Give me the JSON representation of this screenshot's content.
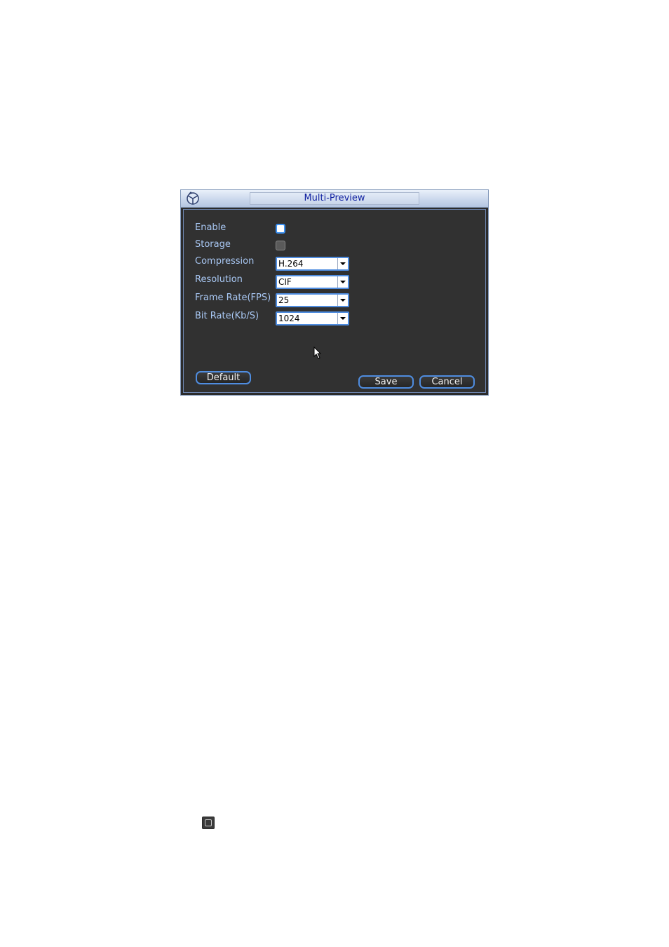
{
  "dialog": {
    "title": "Multi-Preview",
    "icon": "dvr-logo-icon",
    "fields": {
      "enable_label": "Enable",
      "storage_label": "Storage",
      "compression_label": "Compression",
      "compression_value": "H.264",
      "resolution_label": "Resolution",
      "resolution_value": "CIF",
      "framerate_label": "Frame Rate(FPS)",
      "framerate_value": "25",
      "bitrate_label": "Bit Rate(Kb/S)",
      "bitrate_value": "1024"
    },
    "buttons": {
      "default_label": "Default",
      "save_label": "Save",
      "cancel_label": "Cancel"
    }
  },
  "colors": {
    "label": "#a9c8f4",
    "accent": "#4f8de0",
    "panel": "#313131"
  }
}
